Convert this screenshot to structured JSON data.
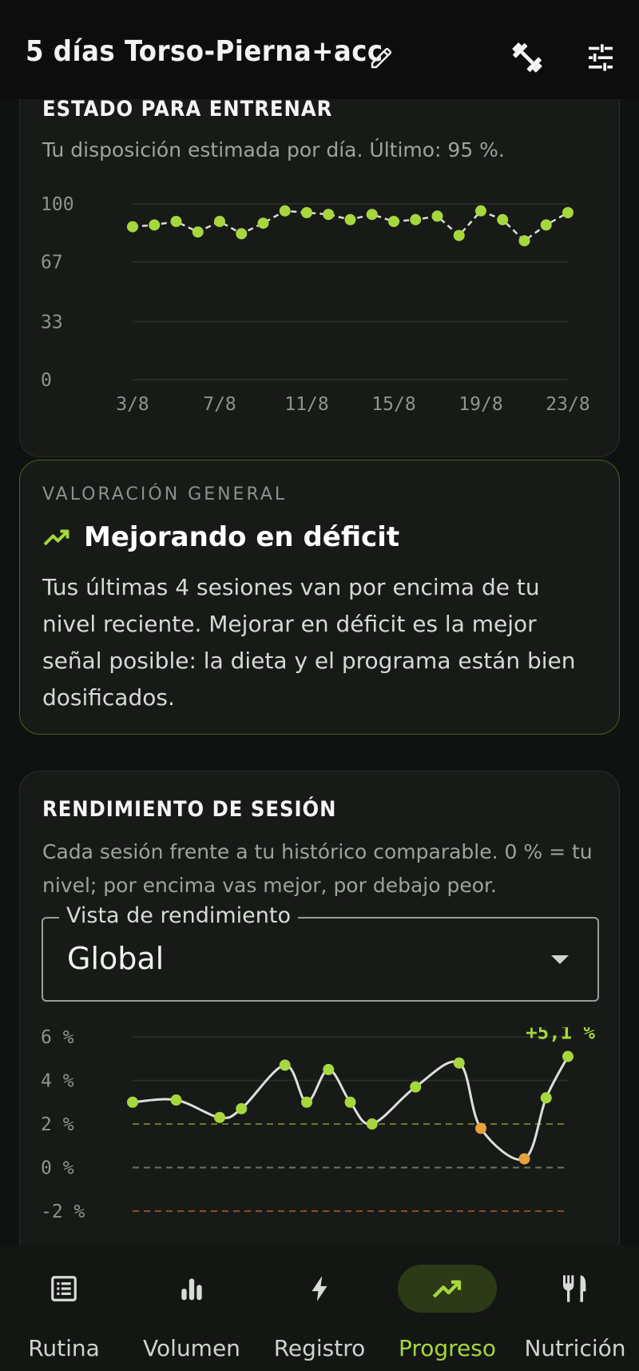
{
  "header": {
    "title": "5 días Torso-Pierna+acc"
  },
  "readiness": {
    "heading": "ESTADO PARA ENTRENAR",
    "subtitle": "Tu disposición estimada por día. Último: 95 %.",
    "chart_data": {
      "type": "line",
      "title": "",
      "xlabel": "",
      "ylabel": "",
      "ylim": [
        0,
        100
      ],
      "yticks": [
        "100",
        "67",
        "33",
        "0"
      ],
      "xticks": [
        "3/8",
        "7/8",
        "11/8",
        "15/8",
        "19/8",
        "23/8"
      ],
      "x": [
        "3/8",
        "4/8",
        "5/8",
        "6/8",
        "7/8",
        "8/8",
        "9/8",
        "10/8",
        "11/8",
        "12/8",
        "13/8",
        "14/8",
        "15/8",
        "16/8",
        "17/8",
        "18/8",
        "19/8",
        "20/8",
        "21/8",
        "22/8",
        "23/8"
      ],
      "values": [
        87,
        88,
        90,
        84,
        90,
        83,
        89,
        96,
        95,
        94,
        91,
        94,
        90,
        91,
        93,
        82,
        96,
        91,
        79,
        88,
        95
      ],
      "color": "#a6d73d",
      "line_style": "dashed",
      "grid": true
    }
  },
  "assessment": {
    "eyebrow": "VALORACIÓN GENERAL",
    "headline": "Mejorando en déficit",
    "icon": "trending-up-icon",
    "body": "Tus últimas 4 sesiones van por encima de tu nivel reciente. Mejorar en déficit es la mejor señal posible: la dieta y el programa están bien dosificados."
  },
  "performance": {
    "heading": "RENDIMIENTO DE SESIÓN",
    "subtitle": "Cada sesión frente a tu histórico comparable. 0 % = tu nivel; por encima vas mejor, por debajo peor.",
    "select": {
      "label": "Vista de rendimiento",
      "value": "Global"
    },
    "chart_data": {
      "type": "line",
      "title": "",
      "xlabel": "",
      "ylabel": "",
      "ylim": [
        -2,
        6
      ],
      "yticks": [
        "6 %",
        "4 %",
        "2 %",
        "0 %",
        "-2 %"
      ],
      "x": [
        3,
        5,
        7,
        8,
        10,
        11,
        12,
        13,
        14,
        16,
        18,
        19,
        21,
        22,
        23
      ],
      "values": [
        3.0,
        3.1,
        2.3,
        2.7,
        4.7,
        3.0,
        4.5,
        3.0,
        2.0,
        3.7,
        4.8,
        1.8,
        0.4,
        3.2,
        5.1
      ],
      "point_status": [
        "good",
        "good",
        "good",
        "good",
        "good",
        "good",
        "good",
        "good",
        "good",
        "good",
        "good",
        "warn",
        "warn",
        "good",
        "good"
      ],
      "good_color": "#a6d73d",
      "warn_color": "#e7a13b",
      "reference_lines": [
        {
          "value": 2,
          "color": "#6b7a2c",
          "style": "dashed"
        },
        {
          "value": 0,
          "color": "#6e706e",
          "style": "dashed"
        },
        {
          "value": -2,
          "color": "#8a4f2a",
          "style": "dashed"
        }
      ],
      "last_label": "+5,1 %"
    }
  },
  "nav": {
    "items": [
      {
        "label": "Rutina",
        "icon": "list-icon"
      },
      {
        "label": "Volumen",
        "icon": "bar-chart-icon"
      },
      {
        "label": "Registro",
        "icon": "bolt-icon"
      },
      {
        "label": "Progreso",
        "icon": "trending-up-icon",
        "active": true
      },
      {
        "label": "Nutrición",
        "icon": "fork-knife-icon"
      }
    ]
  }
}
